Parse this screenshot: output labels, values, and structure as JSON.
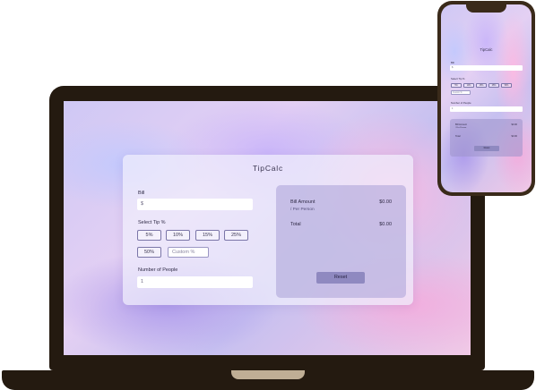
{
  "app": {
    "title": "TipCalc",
    "bill_label": "Bill",
    "bill_placeholder": "$",
    "tip_label": "Select Tip %",
    "tip_options": [
      "5%",
      "10%",
      "15%",
      "25%",
      "50%"
    ],
    "custom_placeholder": "Custom %",
    "people_label": "Number of People",
    "people_value": "1",
    "results": {
      "bill_amount_label": "Bill Amount",
      "per_person_label": "/ Per Person",
      "bill_amount_value": "$0.00",
      "total_label": "Total",
      "total_value": "$0.00"
    },
    "reset_label": "Reset"
  },
  "colors": {
    "device_frame": "#241a10",
    "accent": "#8f89c0",
    "panel": "#aaa0d7"
  }
}
